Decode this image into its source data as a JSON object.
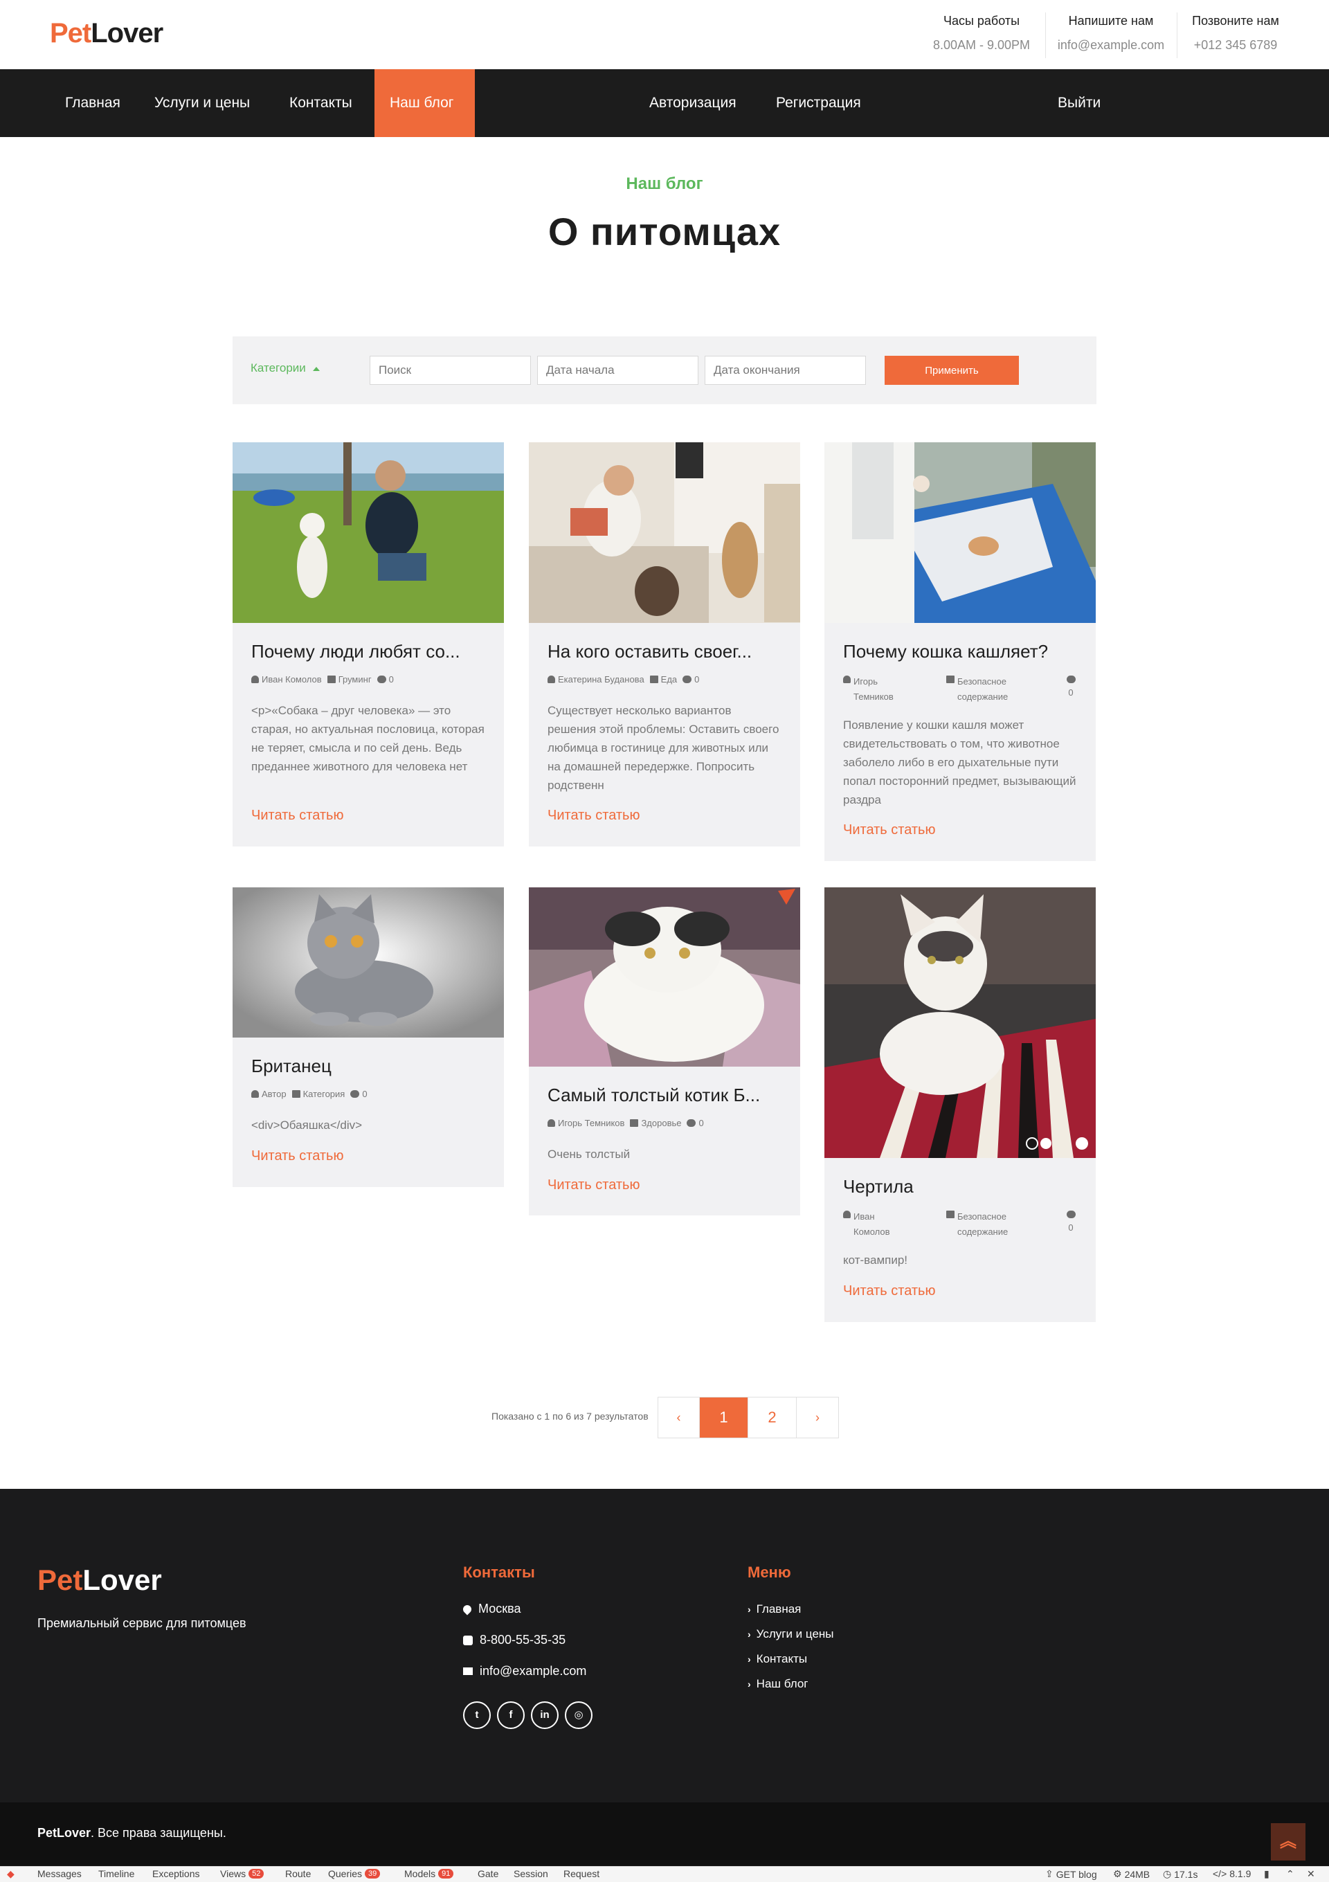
{
  "brand": {
    "pet": "Pet",
    "lover": "Lover"
  },
  "topinfo": [
    {
      "heading": "Часы работы",
      "value": "8.00AM - 9.00PM"
    },
    {
      "heading": "Напишите нам",
      "value": "info@example.com"
    },
    {
      "heading": "Позвоните нам",
      "value": "+012 345 6789"
    }
  ],
  "nav": {
    "home": "Главная",
    "services": "Услуги и цены",
    "contacts": "Контакты",
    "blog": "Наш блог",
    "login": "Авторизация",
    "register": "Регистрация",
    "logout": "Выйти"
  },
  "heading": {
    "kicker": "Наш блог",
    "title": "О питомцах"
  },
  "filter": {
    "categories": "Категории",
    "search_placeholder": "Поиск",
    "start_placeholder": "Дата начала",
    "end_placeholder": "Дата окончания",
    "apply": "Применить"
  },
  "posts": [
    {
      "title": "Почему люди любят со...",
      "author": "Иван Комолов",
      "category": "Груминг",
      "comments": "0",
      "excerpt": "<p>«Собака – друг человека» — это старая, но актуальная пословица, которая не теряет, смысла и по сей день. Ведь преданнее животного для человека нет",
      "read": "Читать статью"
    },
    {
      "title": "На кого оставить своег...",
      "author": "Екатерина Буданова",
      "category": "Еда",
      "comments": "0",
      "excerpt": "Существует несколько вариантов решения этой проблемы: Оставить своего любимца в гостинице для животных или на домашней передержке. Попросить родственн",
      "read": "Читать статью"
    },
    {
      "title": "Почему кошка кашляет?",
      "author": "Игорь Темников",
      "category": "Безопасное содержание",
      "comments": "0",
      "excerpt": "Появление у кошки кашля может свидетельствовать о том, что животное заболело либо в его дыхательные пути попал посторонний предмет, вызывающий раздра",
      "read": "Читать статью"
    },
    {
      "title": "Британец",
      "author": "Автор",
      "category": "Категория",
      "comments": "0",
      "excerpt": "<div>Обаяшка</div>",
      "read": "Читать статью"
    },
    {
      "title": "Самый толстый котик Б...",
      "author": "Игорь Темников",
      "category": "Здоровье",
      "comments": "0",
      "excerpt": "Очень толстый",
      "read": "Читать статью"
    },
    {
      "title": "Чертила",
      "author": "Иван Комолов",
      "category": "Безопасное содержание",
      "comments": "0",
      "excerpt": "кот-вампир!",
      "read": "Читать статью"
    }
  ],
  "pagination": {
    "info": "Показано с 1 по 6 из 7 результатов",
    "prev": "‹",
    "pages": [
      "1",
      "2"
    ],
    "next": "›",
    "current": "1"
  },
  "footer": {
    "tagline": "Премиальный сервис для питомцев",
    "contacts_heading": "Контакты",
    "city": "Москва",
    "phone": "8-800-55-35-35",
    "email": "info@example.com",
    "menu_heading": "Меню",
    "menu": [
      "Главная",
      "Услуги и цены",
      "Контакты",
      "Наш блог"
    ],
    "social": [
      "twitter-icon",
      "facebook-icon",
      "linkedin-icon",
      "instagram-icon"
    ],
    "copyright_brand": "PetLover",
    "copyright_text": ". Все права защищены."
  },
  "debugbar": {
    "messages": "Messages",
    "timeline": "Timeline",
    "exceptions": "Exceptions",
    "views": "Views",
    "views_count": "52",
    "route": "Route",
    "queries": "Queries",
    "queries_count": "39",
    "models": "Models",
    "models_count": "91",
    "gate": "Gate",
    "session": "Session",
    "request": "Request",
    "method": "GET blog",
    "memory": "24MB",
    "time": "17.1s",
    "version": "8.1.9"
  },
  "colors": {
    "accent": "#ef6a3a",
    "green": "#5cb85c",
    "dark": "#1c1c1c"
  }
}
